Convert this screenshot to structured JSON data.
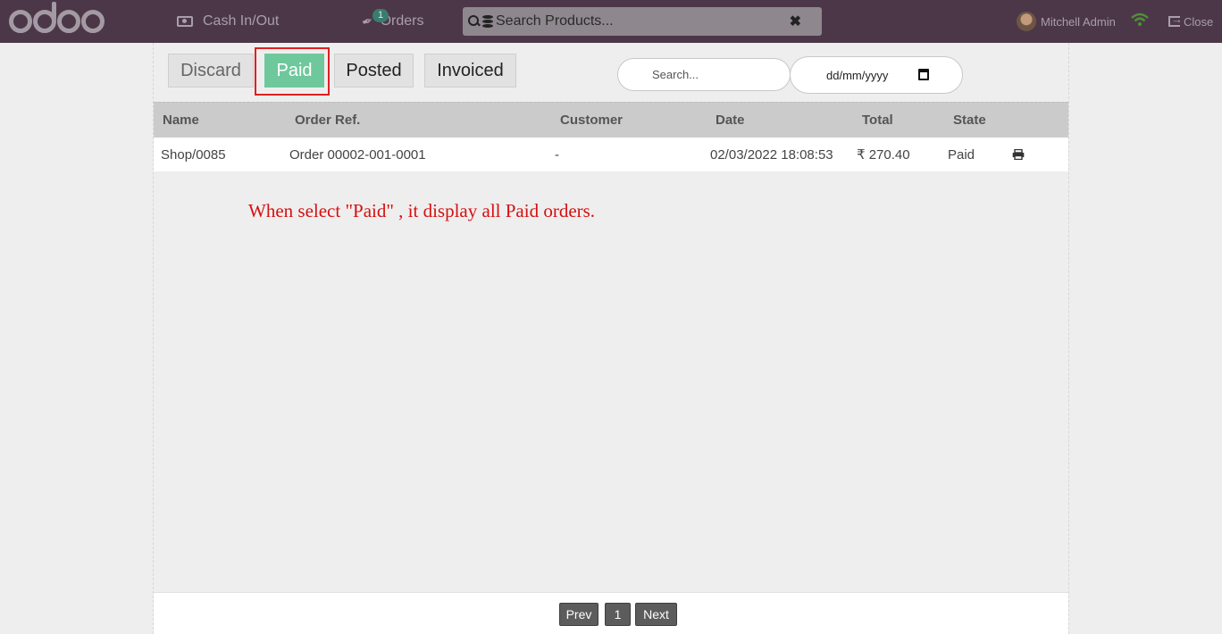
{
  "topbar": {
    "cash_label": "Cash In/Out",
    "orders_label": "Orders",
    "orders_badge": "1",
    "search_placeholder": "Search Products...",
    "clear_symbol": "✖",
    "user_name": "Mitchell Admin",
    "close_label": "Close"
  },
  "filters": {
    "discard": "Discard",
    "paid": "Paid",
    "posted": "Posted",
    "invoiced": "Invoiced",
    "search_placeholder": "Search...",
    "date_placeholder": "dd/mm/yyyy",
    "active": "Paid"
  },
  "table": {
    "columns": [
      "Name",
      "Order Ref.",
      "Customer",
      "Date",
      "Total",
      "State"
    ],
    "rows": [
      {
        "name": "Shop/0085",
        "order_ref": "Order 00002-001-0001",
        "customer": "-",
        "date": "02/03/2022 18:08:53",
        "total": "₹ 270.40",
        "state": "Paid"
      }
    ]
  },
  "annotation": "When select \"Paid\" , it display all Paid orders.",
  "pagination": {
    "prev": "Prev",
    "page": "1",
    "next": "Next"
  },
  "colors": {
    "topbar": "#4c3748",
    "paid_active": "#6ec89b",
    "highlight_border": "#e02020",
    "annotation_text": "#d41010"
  },
  "icons": [
    "cash-icon",
    "tag-icon",
    "search-icon",
    "database-icon",
    "close-icon",
    "avatar",
    "wifi-icon",
    "exit-icon",
    "calendar-icon",
    "print-icon"
  ]
}
